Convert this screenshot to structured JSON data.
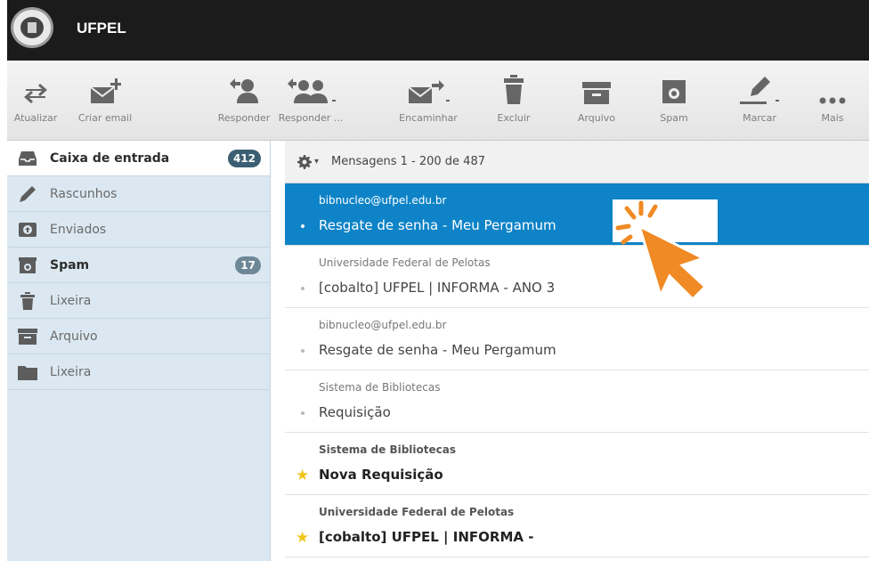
{
  "app": {
    "brand": "UFPEL"
  },
  "toolbar": {
    "buttons": [
      {
        "label": "Atualizar",
        "icon": "refresh-icon"
      },
      {
        "label": "Criar email",
        "icon": "compose-icon"
      },
      {
        "label": "Responder",
        "icon": "reply-icon"
      },
      {
        "label": "Responder ...",
        "icon": "reply-all-icon"
      },
      {
        "label": "Encaminhar",
        "icon": "forward-icon"
      },
      {
        "label": "Excluir",
        "icon": "trash-icon"
      },
      {
        "label": "Arquivo",
        "icon": "archive-icon"
      },
      {
        "label": "Spam",
        "icon": "spam-icon"
      },
      {
        "label": "Marcar",
        "icon": "mark-icon"
      },
      {
        "label": "Mais",
        "icon": "more-icon"
      }
    ]
  },
  "sidebar": {
    "folders": [
      {
        "label": "Caixa de entrada",
        "icon": "inbox-icon",
        "badge": "412"
      },
      {
        "label": "Rascunhos",
        "icon": "pencil-icon"
      },
      {
        "label": "Enviados",
        "icon": "sent-icon"
      },
      {
        "label": "Spam",
        "icon": "spam-icon",
        "badge": "17"
      },
      {
        "label": "Lixeira",
        "icon": "trash-icon"
      },
      {
        "label": "Arquivo",
        "icon": "archive-icon"
      },
      {
        "label": "Lixeira",
        "icon": "folder-icon"
      }
    ]
  },
  "list": {
    "count_label": "Mensagens 1 - 200 de 487",
    "messages": [
      {
        "from": "bibnucleo@ufpel.edu.br",
        "subject": "Resgate de senha - Meu Pergamum",
        "selected": true,
        "unread": false,
        "flagged": false
      },
      {
        "from": "Universidade Federal de Pelotas",
        "subject": "[cobalto] UFPEL | INFORMA - ANO 3",
        "selected": false,
        "unread": false,
        "flagged": false
      },
      {
        "from": "bibnucleo@ufpel.edu.br",
        "subject": "Resgate de senha - Meu Pergamum",
        "selected": false,
        "unread": false,
        "flagged": false
      },
      {
        "from": "Sistema de Bibliotecas",
        "subject": "Requisição",
        "selected": false,
        "unread": false,
        "flagged": false
      },
      {
        "from": "Sistema de Bibliotecas",
        "subject": "Nova Requisição",
        "selected": false,
        "unread": true,
        "flagged": true
      },
      {
        "from": "Universidade Federal de Pelotas",
        "subject": "[cobalto] UFPEL | INFORMA -",
        "selected": false,
        "unread": true,
        "flagged": true
      }
    ]
  },
  "colors": {
    "selected": "#0e83c7",
    "sidebar": "#dbe8f1",
    "topbar": "#1b1b1b",
    "pointer": "#f08a24",
    "star": "#f0c419"
  }
}
